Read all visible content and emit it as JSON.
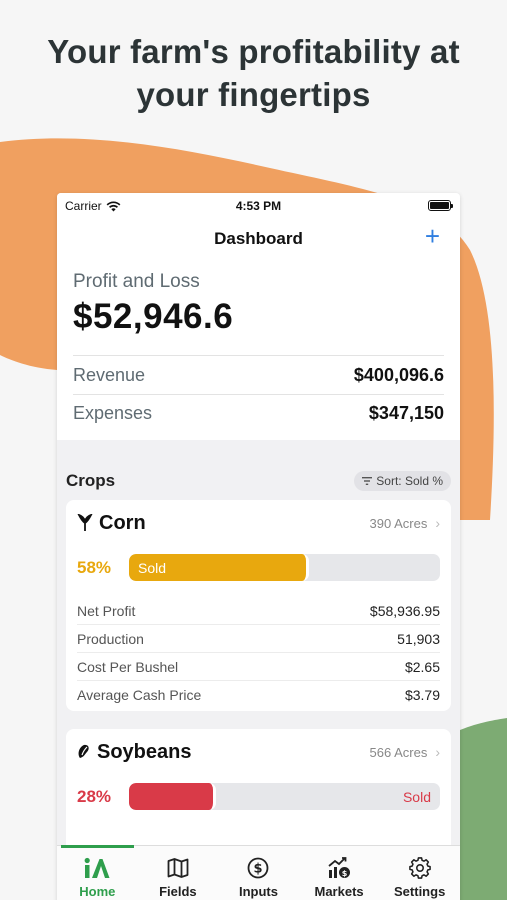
{
  "headline": {
    "line1": "Your farm's profitability at",
    "line2": "your fingertips"
  },
  "colors": {
    "orange_blob": "#f0a060",
    "green_blob": "#7dab73",
    "accent_blue": "#2f7ee0",
    "active_tab": "#2e9e4c",
    "corn_bar": "#e8a80e",
    "soy_bar": "#d93a48"
  },
  "status_bar": {
    "carrier": "Carrier",
    "time": "4:53 PM",
    "icons": [
      "wifi-icon",
      "battery-icon"
    ]
  },
  "nav": {
    "title": "Dashboard",
    "add_icon": "plus-icon",
    "add_label": "+"
  },
  "profit_loss": {
    "label": "Profit and Loss",
    "value": "$52,946.6",
    "rows": [
      {
        "label": "Revenue",
        "value": "$400,096.6"
      },
      {
        "label": "Expenses",
        "value": "$347,150"
      }
    ]
  },
  "crops": {
    "title": "Crops",
    "sort_label": "Sort: Sold %",
    "sort_icon": "filter-icon",
    "items": [
      {
        "name": "Corn",
        "icon": "corn-icon",
        "acres": "390 Acres",
        "percent_label": "58%",
        "sold_fraction": 0.58,
        "bar_label": "Sold",
        "details": [
          {
            "label": "Net Profit",
            "value": "$58,936.95"
          },
          {
            "label": "Production",
            "value": "51,903"
          },
          {
            "label": "Cost Per Bushel",
            "value": "$2.65"
          },
          {
            "label": "Average Cash Price",
            "value": "$3.79"
          }
        ]
      },
      {
        "name": "Soybeans",
        "icon": "soybean-icon",
        "acres": "566 Acres",
        "percent_label": "28%",
        "sold_fraction": 0.28,
        "bar_label": "Sold"
      }
    ]
  },
  "tabs": [
    {
      "label": "Home",
      "icon": "home-logo-icon",
      "active": true
    },
    {
      "label": "Fields",
      "icon": "map-icon",
      "active": false
    },
    {
      "label": "Inputs",
      "icon": "dollar-circle-icon",
      "active": false
    },
    {
      "label": "Markets",
      "icon": "chart-dollar-icon",
      "active": false
    },
    {
      "label": "Settings",
      "icon": "gear-icon",
      "active": false
    }
  ]
}
